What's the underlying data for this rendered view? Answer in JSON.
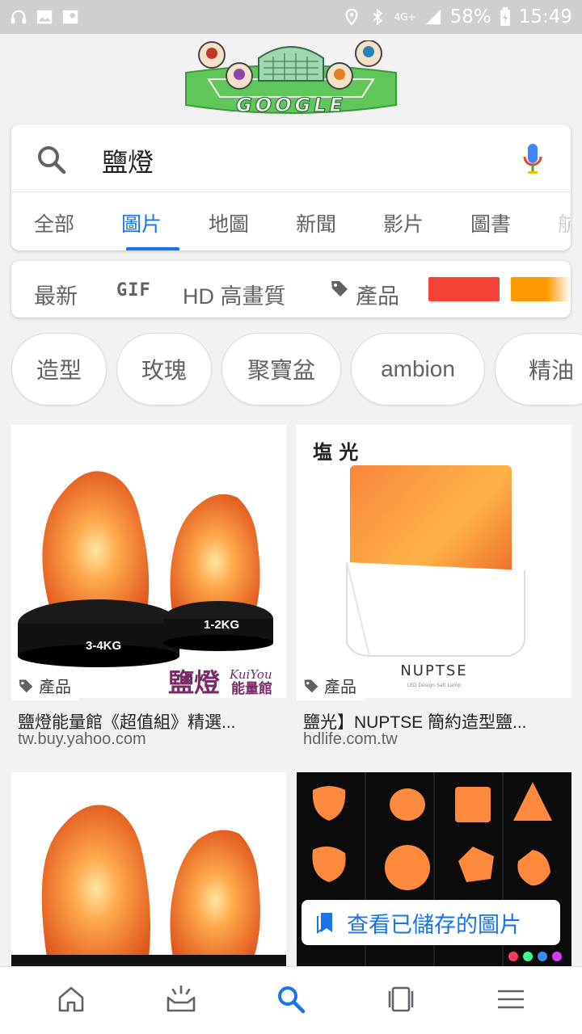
{
  "status_bar": {
    "battery": "58%",
    "time": "15:49",
    "network": "4G+"
  },
  "doodle": {
    "text": "GOOGLE"
  },
  "search": {
    "query": "鹽燈",
    "icons": {
      "search": "search-icon",
      "mic": "mic-icon"
    }
  },
  "tabs": [
    {
      "label": "全部",
      "active": false
    },
    {
      "label": "圖片",
      "active": true
    },
    {
      "label": "地圖",
      "active": false
    },
    {
      "label": "新聞",
      "active": false
    },
    {
      "label": "影片",
      "active": false
    },
    {
      "label": "圖書",
      "active": false
    },
    {
      "label": "航",
      "active": false
    }
  ],
  "filters": {
    "latest": "最新",
    "gif": "GIF",
    "hd": "HD 高畫質",
    "products": "產品",
    "color_swatches": [
      "#f44336",
      "#ff9800"
    ]
  },
  "chips": [
    "造型",
    "玫瑰",
    "聚寶盆",
    "ambion",
    "精油"
  ],
  "results": [
    {
      "badge": "產品",
      "title": "鹽燈能量館《超值組》精選...",
      "site": "tw.buy.yahoo.com",
      "image_text": {
        "big": "3-4KG",
        "small": "1-2KG",
        "brand_cn": "鹽燈",
        "brand_en": "KuiYou",
        "brand_sub": "能量館"
      }
    },
    {
      "badge": "產品",
      "title": "鹽光】NUPTSE 簡約造型鹽...",
      "site": "hdlife.com.tw",
      "image_text": {
        "logo": "塩 光",
        "brand": "NUPTSE",
        "sub": "LED Design Salt Lamp"
      }
    }
  ],
  "saved_button": {
    "label": "查看已儲存的圖片"
  },
  "bottom_nav": [
    "home-icon",
    "updates-icon",
    "search-icon",
    "tabs-icon",
    "menu-icon"
  ],
  "colors": {
    "accent": "#1a73e8",
    "lamp_orange": "#f07a2e"
  }
}
